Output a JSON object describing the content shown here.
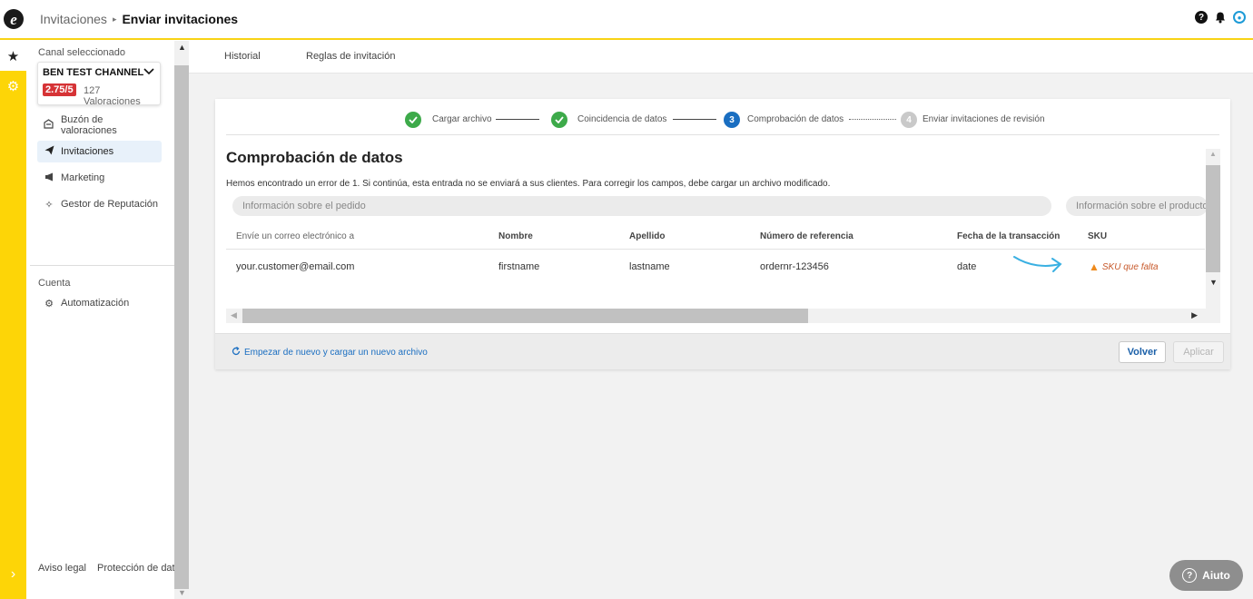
{
  "header": {
    "breadcrumb_parent": "Invitaciones",
    "breadcrumb_separator": "▸",
    "breadcrumb_current": "Enviar invitaciones",
    "icons": [
      "help-icon",
      "bell-icon",
      "user-icon"
    ]
  },
  "rail": {
    "items": [
      "star-icon",
      "gear-icon"
    ],
    "expand_icon": "chevron-right-icon"
  },
  "sidebar": {
    "channel_label": "Canal seleccionado",
    "channel_name": "BEN TEST CHANNEL",
    "rating": "2.75/5",
    "rating_count": "127 Valoraciones",
    "nav": [
      {
        "label": "Buzón de valoraciones",
        "icon": "inbox-icon"
      },
      {
        "label": "Invitaciones",
        "icon": "paper-plane-icon",
        "active": true
      },
      {
        "label": "Marketing",
        "icon": "megaphone-icon"
      },
      {
        "label": "Gestor de Reputación",
        "icon": "sparkle-icon"
      }
    ],
    "account_label": "Cuenta",
    "account_nav": [
      {
        "label": "Automatización",
        "icon": "gears-icon"
      }
    ],
    "footer_links": [
      "Aviso legal",
      "Protección de datos"
    ]
  },
  "tabs": [
    "Historial",
    "Reglas de invitación"
  ],
  "stepper": {
    "steps": [
      {
        "label": "Cargar archivo",
        "state": "done",
        "number": "✓"
      },
      {
        "label": "Coincidencia de datos",
        "state": "done",
        "number": "✓"
      },
      {
        "label": "Comprobación de datos",
        "state": "current",
        "number": "3"
      },
      {
        "label": "Enviar invitaciones de revisión",
        "state": "todo",
        "number": "4"
      }
    ]
  },
  "check": {
    "title": "Comprobación de datos",
    "error_message": "Hemos encontrado un error de 1. Si continúa, esta entrada no se enviará a sus clientes. Para corregir los campos, debe cargar un archivo modificado.",
    "groups": [
      "Información sobre el pedido",
      "Información sobre el producto"
    ],
    "columns": [
      "Envíe un correo electrónico a",
      "Nombre",
      "Apellido",
      "Número de referencia",
      "Fecha de la transacción",
      "SKU"
    ],
    "row": [
      "your.customer@email.com",
      "firstname",
      "lastname",
      "ordernr-123456",
      "date"
    ],
    "sku_warning": "SKU que falta"
  },
  "footer": {
    "restart_label": "Empezar de nuevo y cargar un nuevo archivo",
    "back_label": "Volver",
    "apply_label": "Aplicar"
  },
  "help_button": "Aiuto",
  "colors": {
    "brand_yellow": "#fdd507",
    "success_green": "#3daa4a",
    "primary_blue": "#1a6ec1",
    "rating_red": "#d63336",
    "warning_orange": "#ee8a1c"
  }
}
